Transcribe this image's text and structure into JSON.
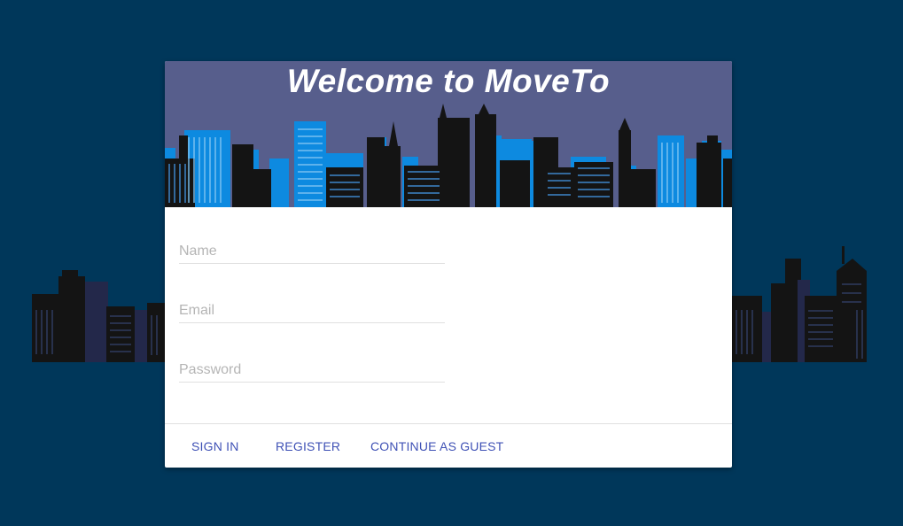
{
  "banner": {
    "title": "Welcome to MoveTo"
  },
  "form": {
    "name": {
      "placeholder": "Name",
      "value": ""
    },
    "email": {
      "placeholder": "Email",
      "value": ""
    },
    "password": {
      "placeholder": "Password",
      "value": ""
    }
  },
  "actions": {
    "sign_in": "SIGN IN",
    "register": "REGISTER",
    "guest": "CONTINUE AS GUEST"
  },
  "colors": {
    "page_background": "#00375a",
    "banner_background": "#575e8c",
    "accent": "#3f51b5",
    "skyline_blue": "#0d8ae0",
    "skyline_dark": "#141414"
  }
}
